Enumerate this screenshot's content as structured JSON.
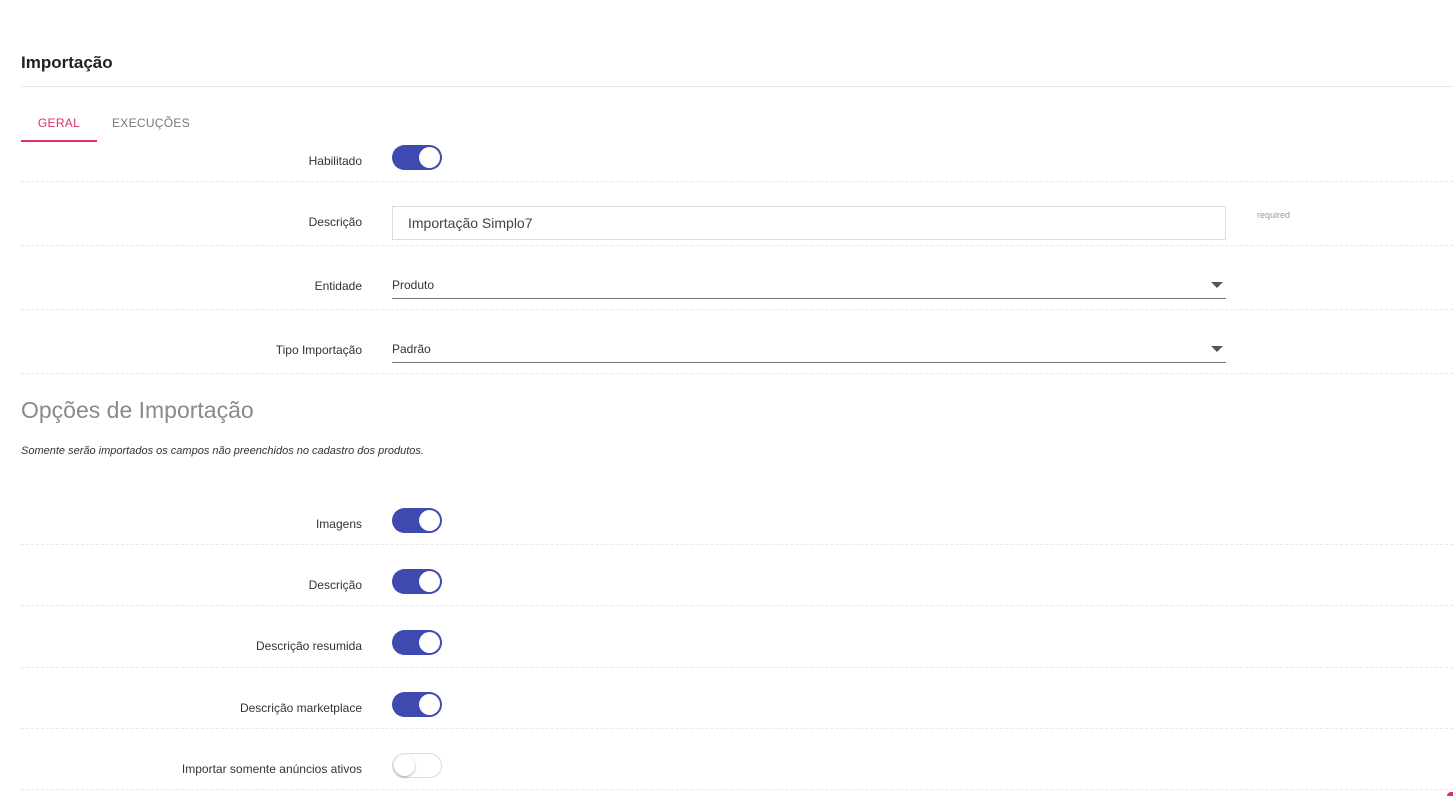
{
  "page": {
    "title": "Importação"
  },
  "tabs": [
    {
      "label": "GERAL",
      "active": true
    },
    {
      "label": "EXECUÇÕES",
      "active": false
    }
  ],
  "form": {
    "habilitado": {
      "label": "Habilitado",
      "checked": true
    },
    "descricao": {
      "label": "Descrição",
      "value": "Importação Simplo7",
      "hint": "required"
    },
    "entidade": {
      "label": "Entidade",
      "selected": "Produto"
    },
    "tipo_importacao": {
      "label": "Tipo Importação",
      "selected": "Padrão"
    }
  },
  "options": {
    "title": "Opções de Importação",
    "note": "Somente serão importados os campos não preenchidos no cadastro dos produtos.",
    "imagens": {
      "label": "Imagens",
      "checked": true
    },
    "descricao": {
      "label": "Descrição",
      "checked": true
    },
    "descricao_resumida": {
      "label": "Descrição resumida",
      "checked": true
    },
    "descricao_marketplace": {
      "label": "Descrição marketplace",
      "checked": true
    },
    "somente_ativos": {
      "label": "Importar somente anúncios ativos",
      "checked": false
    }
  },
  "colors": {
    "accent": "#d6326e",
    "toggle_on": "#3f4ab0"
  },
  "icons": {
    "select_caret": "caret-down-icon"
  }
}
